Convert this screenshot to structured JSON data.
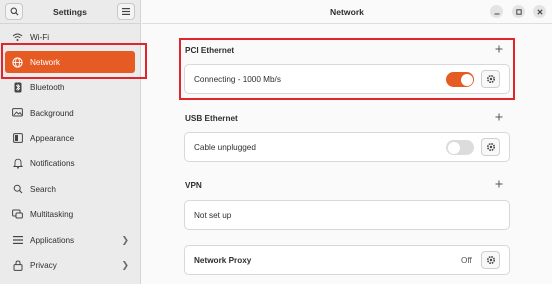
{
  "sidebar": {
    "title": "Settings",
    "items": [
      {
        "label": "Wi-Fi",
        "icon": "wifi-icon"
      },
      {
        "label": "Network",
        "icon": "network-icon",
        "active": true
      },
      {
        "label": "Bluetooth",
        "icon": "bluetooth-icon"
      },
      {
        "label": "Background",
        "icon": "background-icon"
      },
      {
        "label": "Appearance",
        "icon": "appearance-icon"
      },
      {
        "label": "Notifications",
        "icon": "bell-icon"
      },
      {
        "label": "Search",
        "icon": "search-icon"
      },
      {
        "label": "Multitasking",
        "icon": "multitasking-icon"
      },
      {
        "label": "Applications",
        "icon": "grid-icon",
        "chevron": "❯"
      },
      {
        "label": "Privacy",
        "icon": "lock-icon",
        "chevron": "❯"
      }
    ]
  },
  "header": {
    "title": "Network"
  },
  "pci": {
    "title": "PCI Ethernet",
    "status": "Connecting - 1000 Mb/s",
    "enabled": true
  },
  "usb": {
    "title": "USB Ethernet",
    "status": "Cable unplugged",
    "enabled": false
  },
  "vpn": {
    "title": "VPN",
    "status": "Not set up"
  },
  "proxy": {
    "label": "Network Proxy",
    "value": "Off"
  },
  "colors": {
    "accent": "#e65b24",
    "highlight": "#e0262a",
    "toggle_off": "#dcdcdc"
  }
}
